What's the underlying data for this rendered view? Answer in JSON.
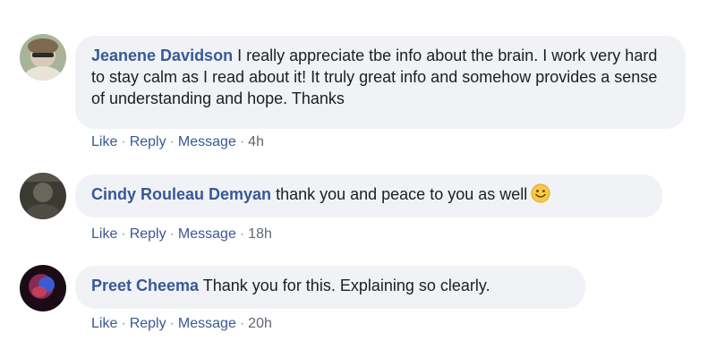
{
  "comments": [
    {
      "author": "Jeanene Davidson",
      "text": "I really appreciate tbe info about the brain. I work very hard to stay calm as I read about it! It truly great info and somehow provides a sense of understanding and hope. Thanks",
      "actions": {
        "like": "Like",
        "reply": "Reply",
        "message": "Message",
        "time": "4h"
      }
    },
    {
      "author": "Cindy Rouleau Demyan",
      "text": "thank you and peace to you as well",
      "emoji": "smiley-emoji",
      "actions": {
        "like": "Like",
        "reply": "Reply",
        "message": "Message",
        "time": "18h"
      }
    },
    {
      "author": "Preet Cheema",
      "text": "Thank you for this. Explaining so clearly.",
      "actions": {
        "like": "Like",
        "reply": "Reply",
        "message": "Message",
        "time": "20h"
      }
    }
  ],
  "colors": {
    "link": "#385898",
    "bubble": "#f0f2f5",
    "text": "#1c1e21"
  }
}
